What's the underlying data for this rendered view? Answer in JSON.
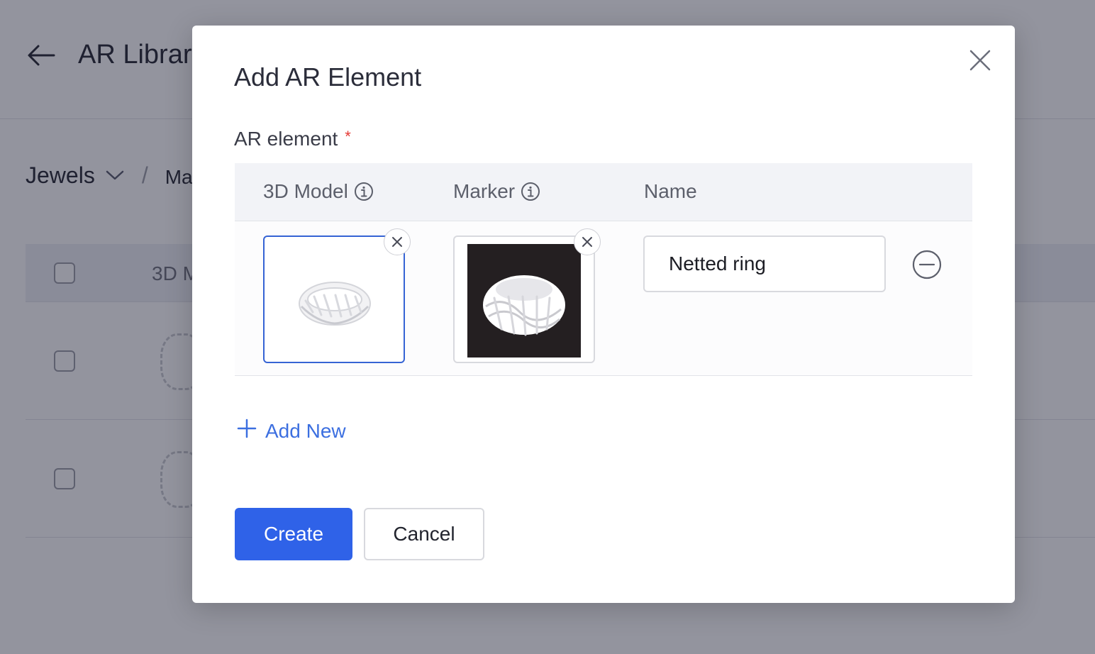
{
  "background": {
    "title": "AR Library",
    "breadcrumb_root": "Jewels",
    "breadcrumb_current": "Ma",
    "table_column": "3D M"
  },
  "modal": {
    "title": "Add AR Element",
    "field_label": "AR element",
    "required_mark": "*",
    "columns": {
      "model": "3D Model",
      "marker": "Marker",
      "name": "Name"
    },
    "row": {
      "name_value": "Netted ring"
    },
    "add_new_label": "Add New",
    "create_label": "Create",
    "cancel_label": "Cancel"
  },
  "icons": [
    "back-arrow-icon",
    "chevron-down-icon",
    "close-icon",
    "info-icon",
    "remove-icon",
    "minus-circle-icon",
    "plus-icon",
    "ring-icon"
  ],
  "colors": {
    "primary": "#2f62e8",
    "link": "#3c6fe0",
    "required": "#e53935",
    "selected_border": "#3563d4"
  }
}
